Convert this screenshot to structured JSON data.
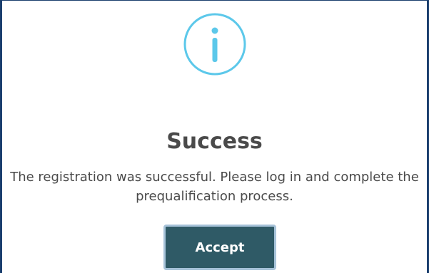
{
  "dialog": {
    "icon": "info-icon",
    "title": "Success",
    "message": "The registration was successful. Please log in and complete the prequalification process.",
    "accept_label": "Accept"
  },
  "colors": {
    "icon_accent": "#5cc8ea",
    "button_background": "#2f5a66",
    "button_border": "#a7c3d9",
    "frame_border": "#1b3f6e",
    "text": "#4a4a4a"
  }
}
